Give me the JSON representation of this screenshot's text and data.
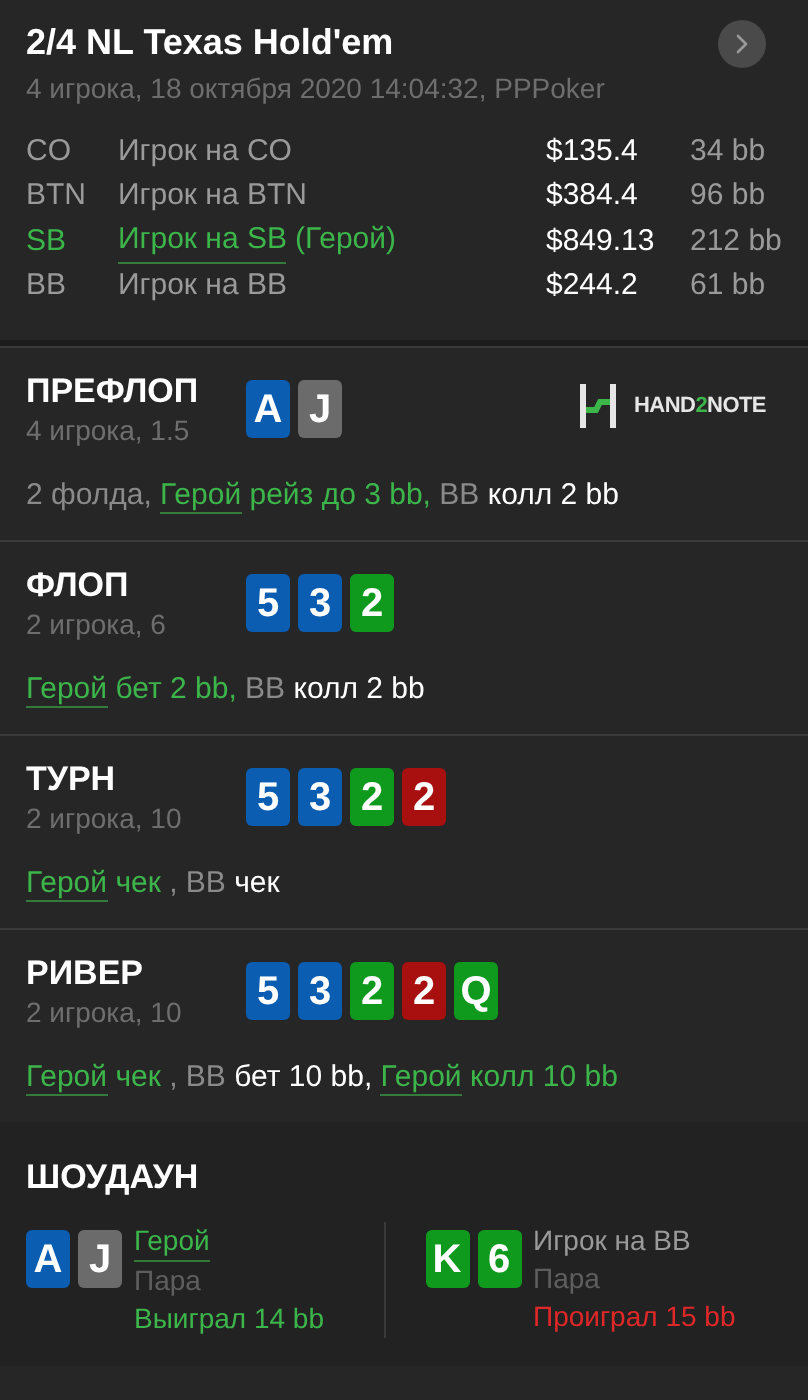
{
  "header": {
    "title": "2/4 NL Texas Hold'em",
    "subtitle": "4 игрока, 18 октября 2020 14:04:32, PPPoker"
  },
  "players": [
    {
      "position": "CO",
      "name": "Игрок на CO",
      "hero": false,
      "stack": "$135.4",
      "bb": "34 bb"
    },
    {
      "position": "BTN",
      "name": "Игрок на BTN",
      "hero": false,
      "stack": "$384.4",
      "bb": "96 bb"
    },
    {
      "position": "SB",
      "name": "Игрок на SB",
      "tag": "(Герой)",
      "hero": true,
      "stack": "$849.13",
      "bb": "212 bb"
    },
    {
      "position": "BB",
      "name": "Игрок на BB",
      "hero": false,
      "stack": "$244.2",
      "bb": "61 bb"
    }
  ],
  "logo": {
    "parts": [
      "HAND",
      "2",
      "NOTE"
    ]
  },
  "streets": [
    {
      "title": "ПРЕФЛОП",
      "info": "4 игрока, 1.5",
      "logo": true,
      "cards": [
        {
          "rank": "A",
          "color": "#0a5db0"
        },
        {
          "rank": "J",
          "color": "#6b6b6b"
        }
      ],
      "actions": [
        {
          "text": "2 фолда, ",
          "kind": "muted"
        },
        {
          "text": "Герой",
          "kind": "link"
        },
        {
          "text": " рейз до 3 bb,",
          "kind": "hero"
        },
        {
          "text": " BB",
          "kind": "muted"
        },
        {
          "text": " колл 2 bb",
          "kind": "white"
        }
      ]
    },
    {
      "title": "ФЛОП",
      "info": "2 игрока, 6",
      "logo": false,
      "cards": [
        {
          "rank": "5",
          "color": "#0a5db0"
        },
        {
          "rank": "3",
          "color": "#0a5db0"
        },
        {
          "rank": "2",
          "color": "#0f9a1e"
        }
      ],
      "actions": [
        {
          "text": "Герой",
          "kind": "link"
        },
        {
          "text": " бет 2 bb,",
          "kind": "hero"
        },
        {
          "text": " BB",
          "kind": "muted"
        },
        {
          "text": " колл 2 bb",
          "kind": "white"
        }
      ]
    },
    {
      "title": "ТУРН",
      "info": "2 игрока, 10",
      "logo": false,
      "cards": [
        {
          "rank": "5",
          "color": "#0a5db0"
        },
        {
          "rank": "3",
          "color": "#0a5db0"
        },
        {
          "rank": "2",
          "color": "#0f9a1e"
        },
        {
          "rank": "2",
          "color": "#a80f0f"
        }
      ],
      "actions": [
        {
          "text": "Герой",
          "kind": "link"
        },
        {
          "text": " чек",
          "kind": "hero"
        },
        {
          "text": " , BB",
          "kind": "muted"
        },
        {
          "text": " чек",
          "kind": "white"
        }
      ]
    },
    {
      "title": "РИВЕР",
      "info": "2 игрока, 10",
      "logo": false,
      "cards": [
        {
          "rank": "5",
          "color": "#0a5db0"
        },
        {
          "rank": "3",
          "color": "#0a5db0"
        },
        {
          "rank": "2",
          "color": "#0f9a1e"
        },
        {
          "rank": "2",
          "color": "#a80f0f"
        },
        {
          "rank": "Q",
          "color": "#0f9a1e"
        }
      ],
      "actions": [
        {
          "text": "Герой",
          "kind": "link"
        },
        {
          "text": " чек",
          "kind": "hero"
        },
        {
          "text": " , BB",
          "kind": "muted"
        },
        {
          "text": " бет 10 bb, ",
          "kind": "white"
        },
        {
          "text": "Герой",
          "kind": "link"
        },
        {
          "text": " колл 10 bb",
          "kind": "hero"
        }
      ]
    }
  ],
  "showdown": {
    "title": "ШОУДАУН",
    "hands": [
      {
        "cards": [
          {
            "rank": "A",
            "color": "#0a5db0"
          },
          {
            "rank": "J",
            "color": "#6b6b6b"
          }
        ],
        "player": "Герой",
        "hero": true,
        "combo": "Пара",
        "result": "Выиграл 14 bb",
        "won": true
      },
      {
        "cards": [
          {
            "rank": "K",
            "color": "#0f9a1e"
          },
          {
            "rank": "6",
            "color": "#0f9a1e"
          }
        ],
        "player": "Игрок на BB",
        "hero": false,
        "combo": "Пара",
        "result": "Проиграл 15 bb",
        "won": false
      }
    ]
  }
}
